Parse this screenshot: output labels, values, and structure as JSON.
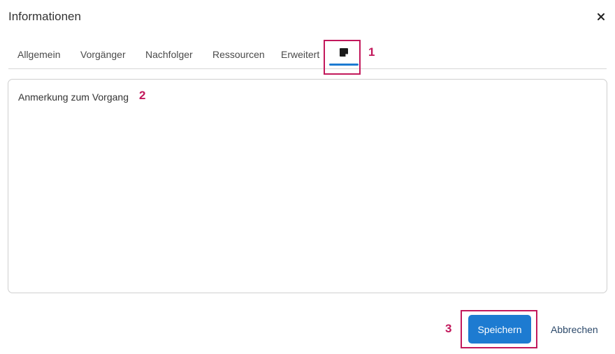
{
  "dialog": {
    "title": "Informationen",
    "close_icon": "close-icon"
  },
  "tabs": [
    {
      "label": "Allgemein"
    },
    {
      "label": "Vorgänger"
    },
    {
      "label": "Nachfolger"
    },
    {
      "label": "Ressourcen"
    },
    {
      "label": "Erweitert"
    },
    {
      "icon": "note-icon",
      "active": true
    }
  ],
  "note": {
    "value": "Anmerkung zum Vorgang"
  },
  "footer": {
    "save_label": "Speichern",
    "cancel_label": "Abbrechen"
  },
  "annotations": [
    "1",
    "2",
    "3"
  ],
  "colors": {
    "accent": "#1d7bd1",
    "annotation": "#c2185b"
  }
}
